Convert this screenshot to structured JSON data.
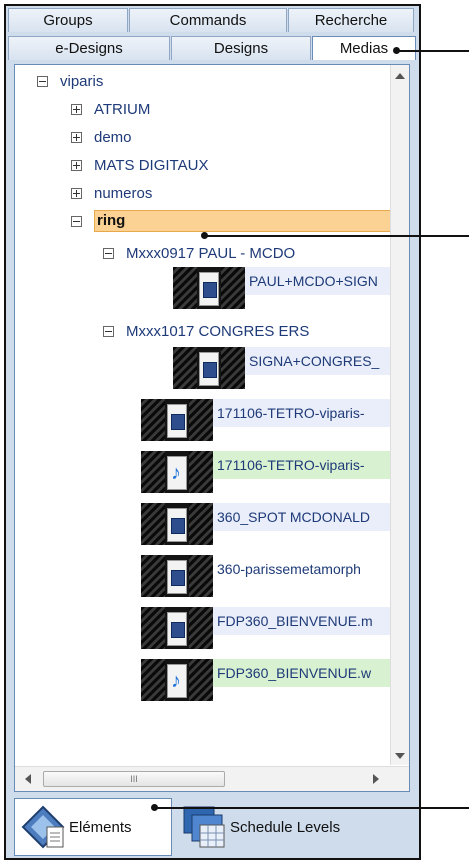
{
  "tabs": {
    "row1": [
      "Groups",
      "Commands",
      "Recherche"
    ],
    "row2": [
      "e-Designs",
      "Designs",
      "Medias"
    ],
    "active": "Medias"
  },
  "tree": {
    "root": "viparis",
    "folders": [
      "ATRIUM",
      "demo",
      "MATS DIGITAUX",
      "numeros"
    ],
    "selected": "ring",
    "subfolders": [
      {
        "label": "Mxxx0917 PAUL - MCDO",
        "file": "PAUL+MCDO+SIGN"
      },
      {
        "label": "Mxxx1017 CONGRES ERS",
        "file": "SIGNA+CONGRES_"
      }
    ],
    "files": [
      {
        "label": "171106-TETRO-viparis-",
        "kind": "video",
        "highlight": "blue"
      },
      {
        "label": "171106-TETRO-viparis-",
        "kind": "audio",
        "highlight": "green"
      },
      {
        "label": "360_SPOT MCDONALD",
        "kind": "video",
        "highlight": "blue"
      },
      {
        "label": "360-parissemetamorph",
        "kind": "video",
        "highlight": "none"
      },
      {
        "label": "FDP360_BIENVENUE.m",
        "kind": "video",
        "highlight": "blue"
      },
      {
        "label": "FDP360_BIENVENUE.w",
        "kind": "audio",
        "highlight": "green"
      }
    ]
  },
  "scrollbar": {
    "thumb_grip": "III"
  },
  "bottom_tabs": [
    "Eléments",
    "Schedule Levels"
  ],
  "colors": {
    "selection": "#fbd294",
    "tree_text": "#1e3a78",
    "panel_bg": "#cfdcec"
  }
}
